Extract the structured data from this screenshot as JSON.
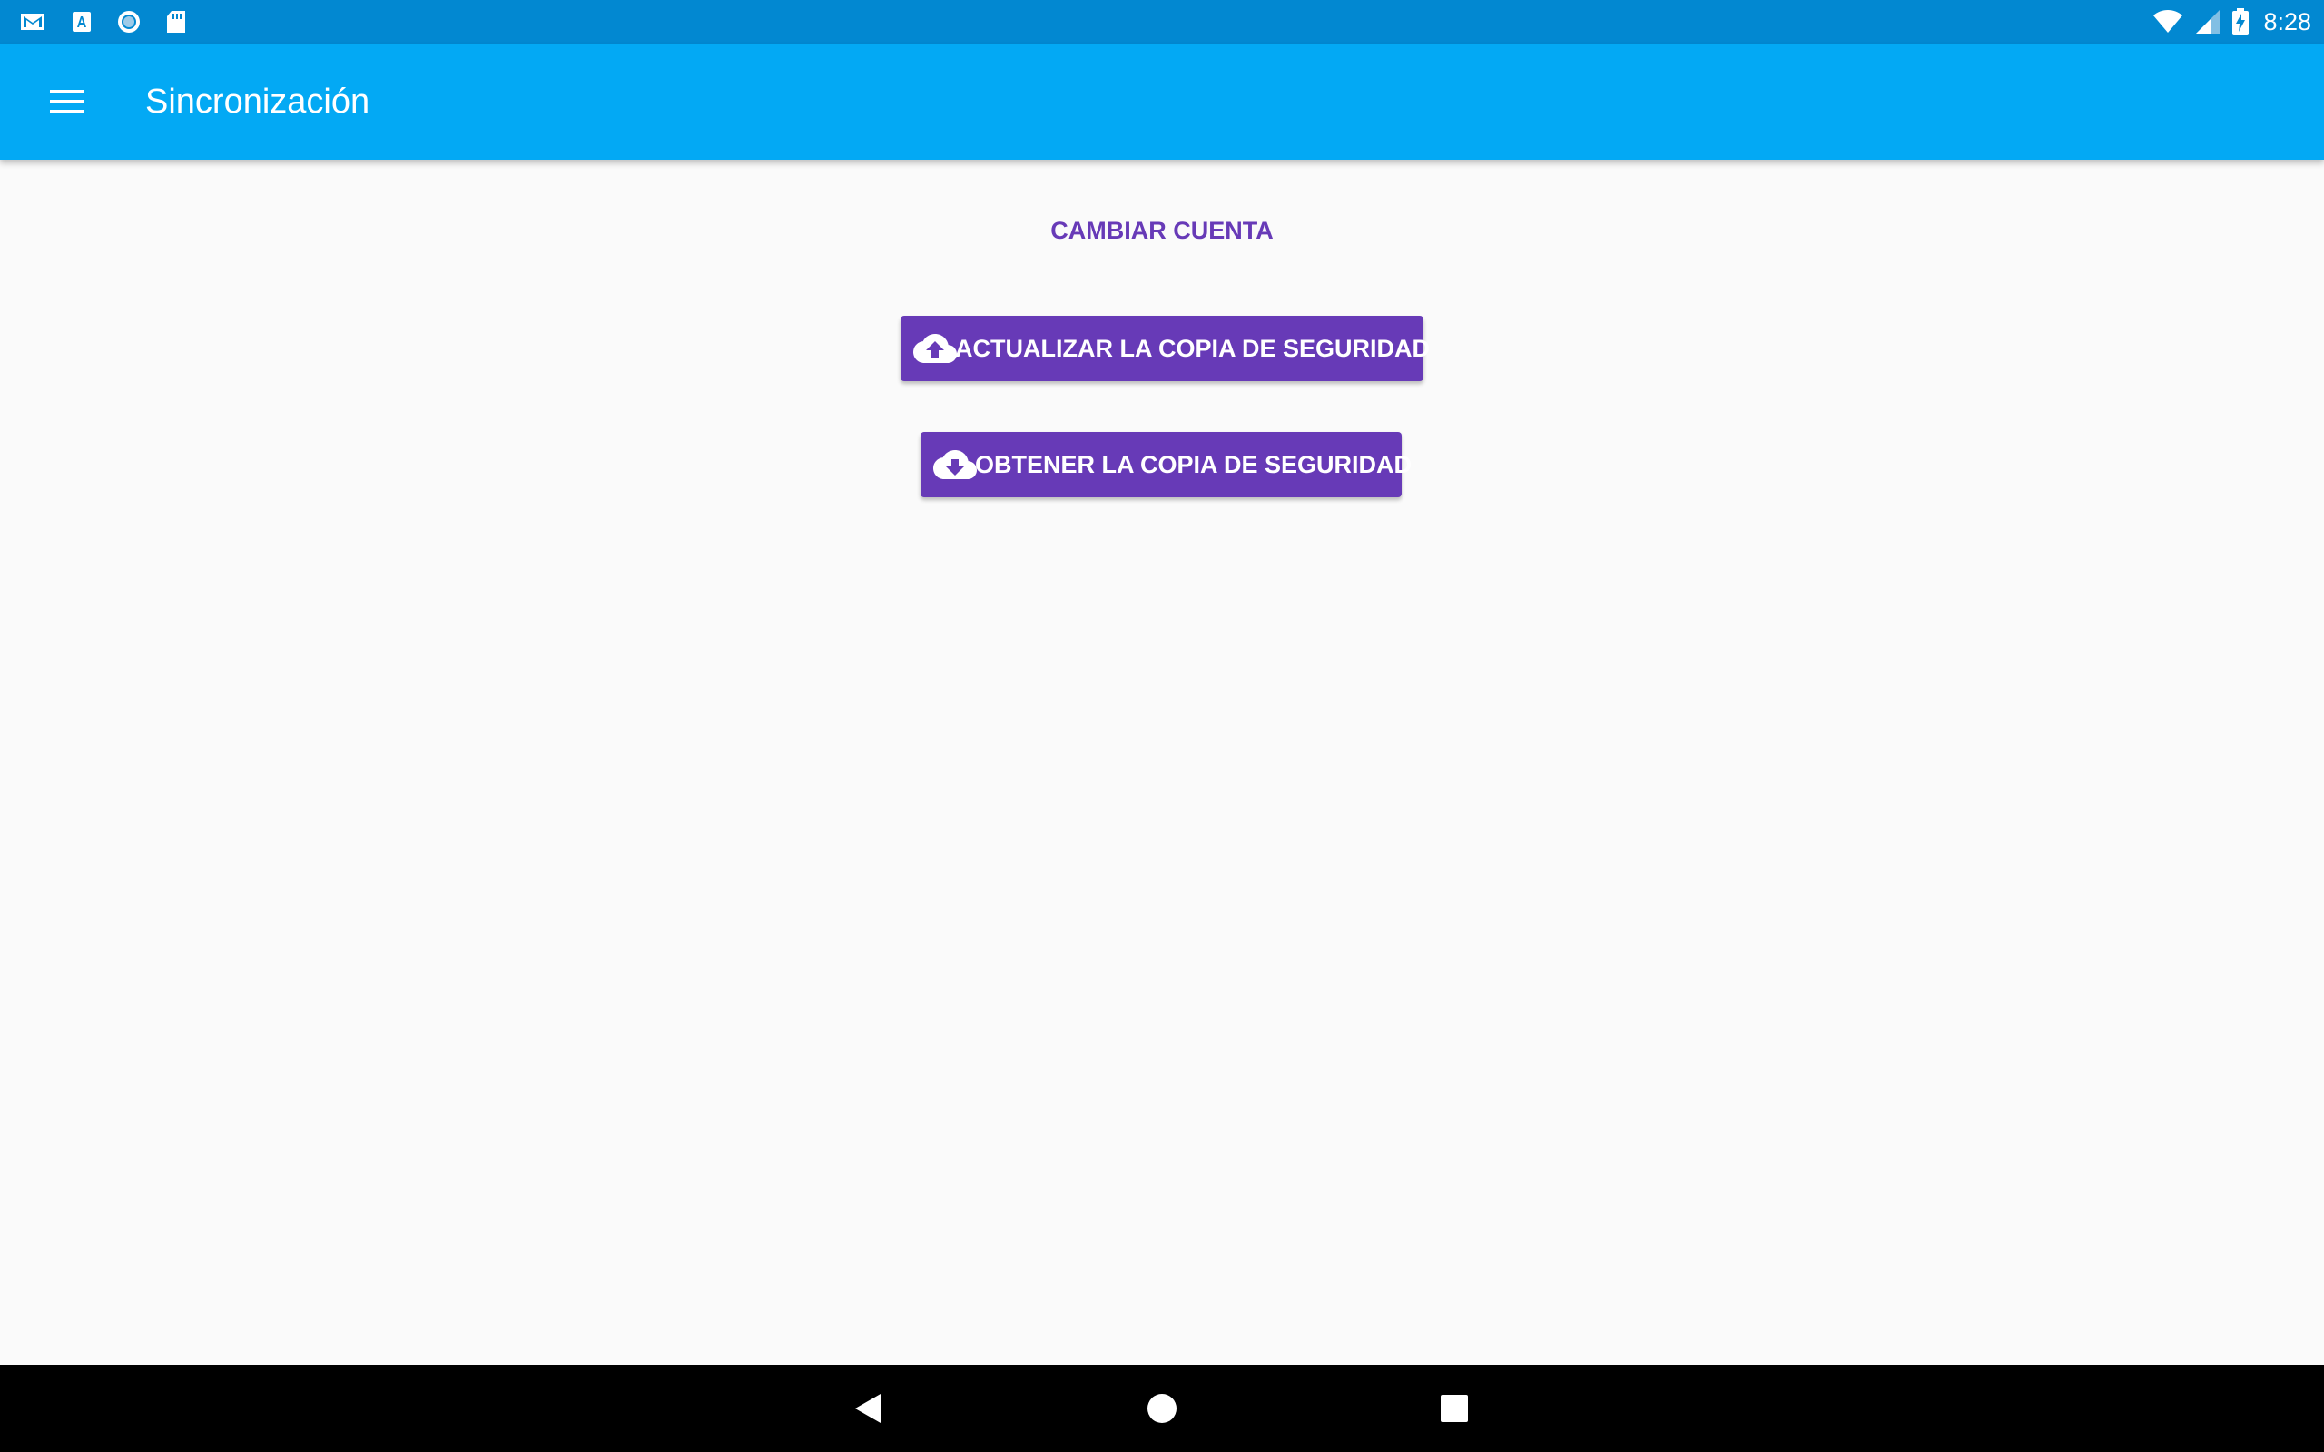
{
  "status_bar": {
    "notifications": [
      "gmail-icon",
      "translate-icon",
      "record-icon",
      "sd-card-icon"
    ],
    "right_icons": [
      "wifi-icon",
      "cellular-signal-icon",
      "battery-charging-icon"
    ],
    "time": "8:28"
  },
  "app_bar": {
    "menu_icon": "hamburger-menu-icon",
    "title": "Sincronización"
  },
  "content": {
    "change_account_label": "CAMBIAR CUENTA",
    "upload_button_label": "ACTUALIZAR LA COPIA DE SEGURIDAD",
    "upload_icon": "cloud-upload-icon",
    "download_button_label": "OBTENER LA COPIA DE SEGURIDAD",
    "download_icon": "cloud-download-icon"
  },
  "nav_bar": {
    "buttons": [
      "back-icon",
      "home-icon",
      "recents-icon"
    ]
  },
  "colors": {
    "status_bar": "#0288d1",
    "app_bar": "#03a9f4",
    "accent": "#673ab7",
    "background": "#fafafa",
    "nav_bar": "#000000"
  }
}
